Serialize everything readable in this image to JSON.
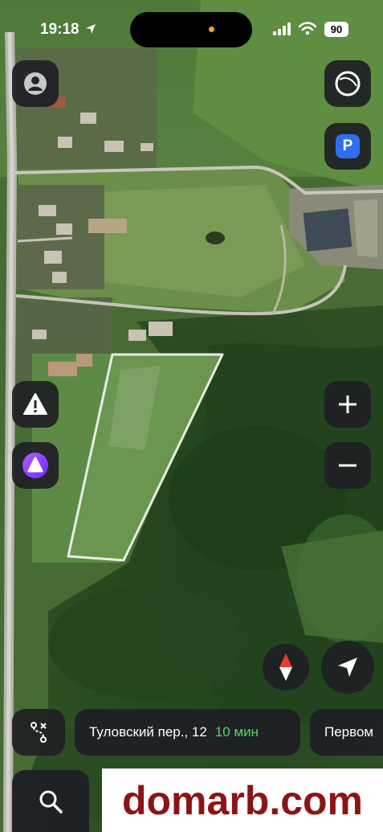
{
  "status_bar": {
    "time": "19:18",
    "battery": "90"
  },
  "map": {
    "type": "satellite",
    "selected_plot": true,
    "accent_color": "#2f6ef0"
  },
  "controls": {
    "profile": "person-icon",
    "layers": "layers-icon",
    "parking": "P",
    "alerts": "warning-icon",
    "assistant": "alice-icon",
    "zoom_in": "plus-icon",
    "zoom_out": "minus-icon",
    "compass": "compass-icon",
    "locate": "navigation-arrow-icon"
  },
  "bottom_bar": {
    "route_address": "Туловский пер., 12",
    "route_time": "10 мин",
    "route_time_color": "#59d36a",
    "next_suggestion": "Первом"
  },
  "watermark": {
    "text": "domarb.com",
    "color": "#8b1414"
  }
}
